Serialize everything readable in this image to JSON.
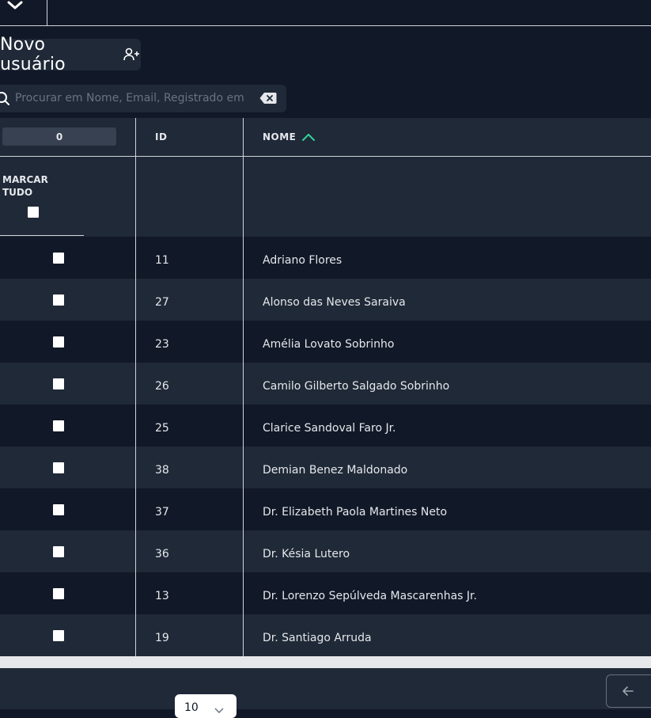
{
  "toolbar": {
    "new_user_label": "Novo usuário"
  },
  "search": {
    "placeholder": "Procurar em Nome, Email, Registrado em",
    "value": ""
  },
  "table": {
    "selected_count": "0",
    "columns": {
      "id": "ID",
      "nome": "NOME"
    },
    "sort": {
      "column": "NOME",
      "direction": "ascending"
    },
    "mark_all_line1": "MARCAR",
    "mark_all_line2": "TUDO",
    "rows": [
      {
        "id": "11",
        "nome": "Adriano Flores"
      },
      {
        "id": "27",
        "nome": "Alonso das Neves Saraiva"
      },
      {
        "id": "23",
        "nome": "Amélia Lovato Sobrinho"
      },
      {
        "id": "26",
        "nome": "Camilo Gilberto Salgado Sobrinho"
      },
      {
        "id": "25",
        "nome": "Clarice Sandoval Faro Jr."
      },
      {
        "id": "38",
        "nome": "Demian Benez Maldonado"
      },
      {
        "id": "37",
        "nome": "Dr. Elizabeth Paola Martines Neto"
      },
      {
        "id": "36",
        "nome": "Dr. Késia Lutero"
      },
      {
        "id": "13",
        "nome": "Dr. Lorenzo Sepúlveda Mascarenhas Jr."
      },
      {
        "id": "19",
        "nome": "Dr. Santiago Arruda"
      }
    ]
  },
  "pagination": {
    "page_size": "10"
  },
  "colors": {
    "background": "#111827",
    "row_alt": "#1f2937",
    "accent": "#34d399",
    "divider": "#d1d5db"
  },
  "icons": [
    "chevron-down-icon",
    "add-user-icon",
    "search-icon",
    "clear-input-icon",
    "sort-ascending-icon",
    "arrow-left-icon"
  ]
}
